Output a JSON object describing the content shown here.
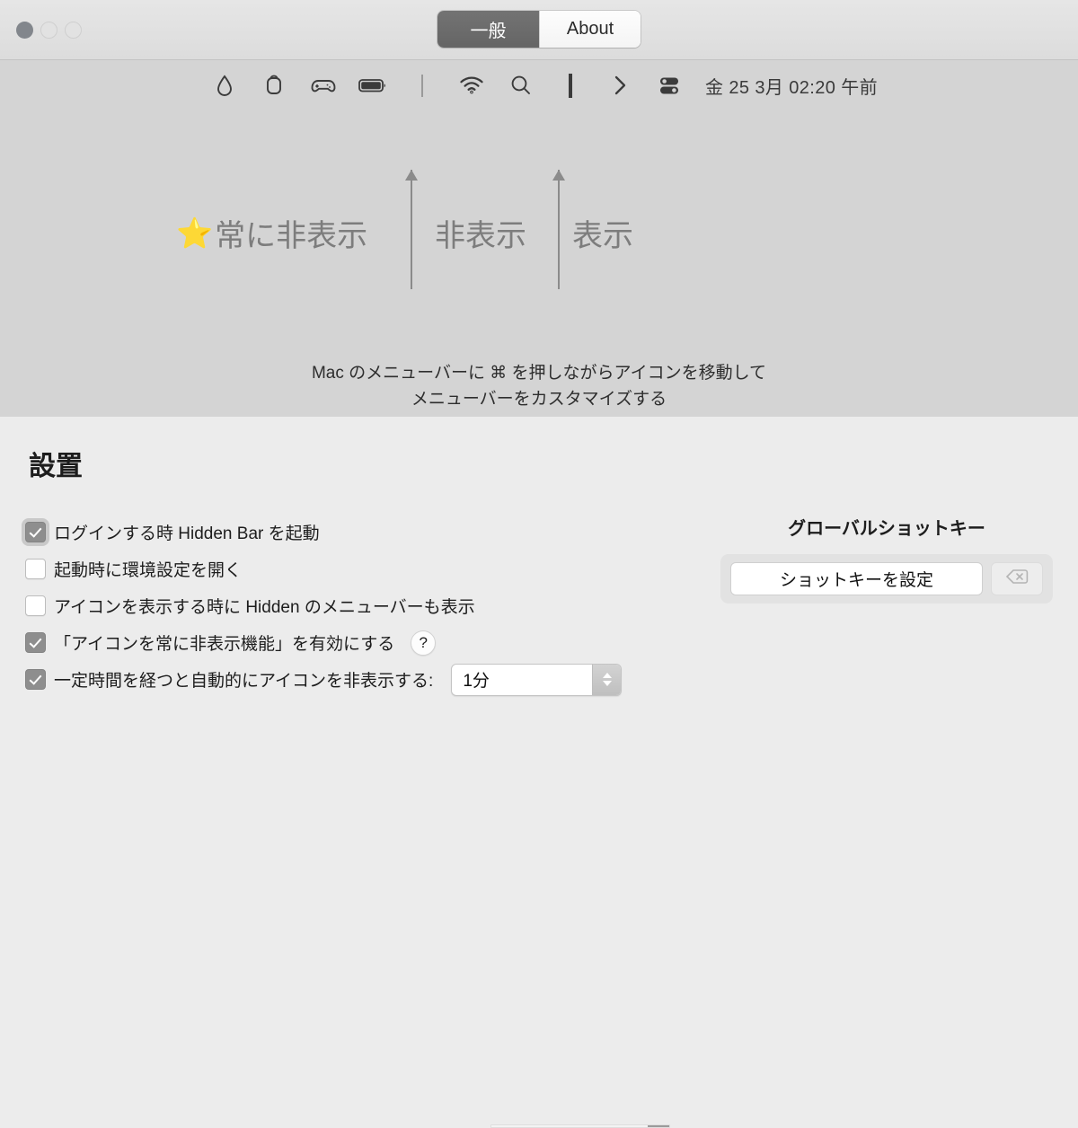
{
  "window": {
    "traffic_lights": [
      "close",
      "minimize",
      "zoom"
    ]
  },
  "tabs": [
    {
      "label": "一般",
      "selected": true
    },
    {
      "label": "About",
      "selected": false
    }
  ],
  "preview": {
    "menubar_icons": [
      {
        "name": "droplet-icon"
      },
      {
        "name": "homepod-icon"
      },
      {
        "name": "game-controller-icon"
      },
      {
        "name": "battery-icon"
      },
      {
        "name": "separator-light-icon"
      },
      {
        "name": "wifi-icon"
      },
      {
        "name": "search-icon"
      },
      {
        "name": "separator-dark-icon"
      },
      {
        "name": "chevron-right-icon"
      },
      {
        "name": "control-center-icon"
      }
    ],
    "clock": "金 25 3月 02:20 午前",
    "zones": [
      {
        "star": "⭐",
        "label": "常に非表示"
      },
      {
        "star": "",
        "label": "非表示"
      },
      {
        "star": "",
        "label": "表示"
      }
    ],
    "hint_line1": "Mac のメニューバーに ⌘ を押しながらアイコンを移動して",
    "hint_line2": "メニューバーをカスタマイズする"
  },
  "settings": {
    "title": "設置",
    "options": [
      {
        "label": "ログインする時 Hidden Bar を起動",
        "checked": true,
        "focused": true
      },
      {
        "label": "起動時に環境設定を開く",
        "checked": false,
        "focused": false
      },
      {
        "label": "アイコンを表示する時に Hidden のメニューバーも表示",
        "checked": false,
        "focused": false
      },
      {
        "label": "「アイコンを常に非表示機能」を有効にする",
        "checked": true,
        "focused": false,
        "help": "?"
      },
      {
        "label": "一定時間を経つと自動的にアイコンを非表示する:",
        "checked": true,
        "focused": false,
        "select_value": "1分"
      }
    ],
    "shortcut": {
      "title": "グローバルショットキー",
      "record_label": "ショットキーを設定",
      "clear_icon": "delete-left-icon"
    }
  },
  "colors": {
    "preview_bg": "#d4d4d4",
    "settings_bg": "#ececec",
    "titlebar_bg": "#e0e0e0",
    "tab_active_bg": "#6b6b6b",
    "checkbox_checked": "#8e8e8e",
    "zone_label": "#7d7d7d",
    "star": "#f7c948"
  }
}
